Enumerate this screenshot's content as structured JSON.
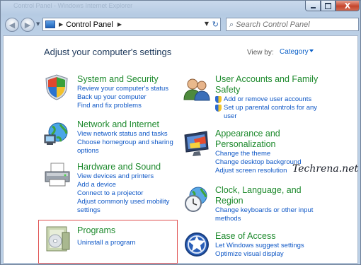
{
  "window": {
    "ghost_title": "Control Panel - Windows Internet Explorer",
    "minimize_glyph": "",
    "close_glyph": "X"
  },
  "nav": {
    "back_glyph": "◀",
    "forward_glyph": "▶",
    "dropdown_glyph": "▼"
  },
  "address": {
    "separator": "▶",
    "location": "Control Panel",
    "trailing_separator": "▶",
    "dropdown_glyph": "▼",
    "refresh_glyph": "↻"
  },
  "search": {
    "placeholder": "Search Control Panel",
    "icon_glyph": "⌕"
  },
  "header": {
    "title": "Adjust your computer's settings",
    "view_by_label": "View by:",
    "view_by_value": "Category"
  },
  "categories": [
    {
      "title": "System and Security",
      "icon": "shield-icon",
      "links": [
        "Review your computer's status",
        "Back up your computer",
        "Find and fix problems"
      ]
    },
    {
      "title": "Network and Internet",
      "icon": "globe-network-icon",
      "links": [
        "View network status and tasks",
        "Choose homegroup and sharing",
        "options"
      ]
    },
    {
      "title": "Hardware and Sound",
      "icon": "printer-icon",
      "links": [
        "View devices and printers",
        "Add a device",
        "Connect to a projector",
        "Adjust commonly used mobility",
        "settings"
      ]
    },
    {
      "title": "Programs",
      "icon": "programs-icon",
      "links": [
        "Uninstall a program"
      ]
    },
    {
      "title_line1": "User Accounts and Family",
      "title_line2": "Safety",
      "icon": "users-icon",
      "links": [
        "Add or remove user accounts",
        "Set up parental controls for any",
        "user"
      ]
    },
    {
      "title_line1": "Appearance and",
      "title_line2": "Personalization",
      "icon": "monitor-icon",
      "links": [
        "Change the theme",
        "Change desktop background",
        "Adjust screen resolution"
      ]
    },
    {
      "title_line1": "Clock, Language, and",
      "title_line2": "Region",
      "icon": "clock-globe-icon",
      "links": [
        "Change keyboards or other input",
        "methods"
      ]
    },
    {
      "title": "Ease of Access",
      "icon": "ease-of-access-icon",
      "links": [
        "Let Windows suggest settings",
        "Optimize visual display"
      ]
    }
  ],
  "watermark": "Techrena.net",
  "colors": {
    "category_title": "#1e8a2d",
    "link": "#0e57c6",
    "highlight_box": "#e05050"
  }
}
